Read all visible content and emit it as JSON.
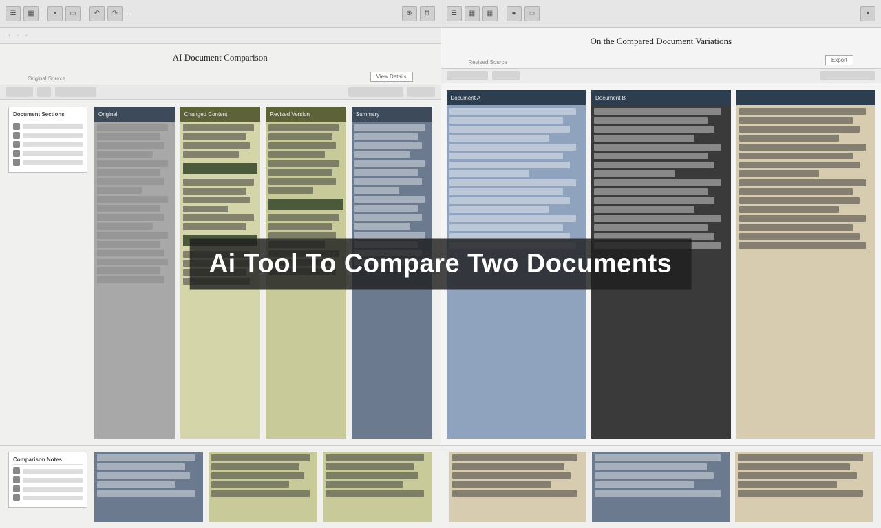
{
  "overlay_caption": "Ai Tool To Compare Two Documents",
  "left_pane": {
    "title": "AI Document Comparison",
    "subtitle": "Original Source",
    "meta_button": "View Details",
    "sidebar": {
      "group1_title": "Document Sections",
      "group2_title": "Comparison Notes"
    },
    "columns": [
      {
        "header": "Original",
        "variant": "dark"
      },
      {
        "header": "Changed Content",
        "variant": "olive"
      },
      {
        "header": "Revised Version",
        "variant": "olive"
      },
      {
        "header": "Summary",
        "variant": "dark"
      }
    ]
  },
  "right_pane": {
    "title": "On the Compared Document Variations",
    "subtitle": "Revised Source",
    "meta_button": "Export",
    "columns": [
      {
        "header": "Document A",
        "variant": "navy"
      },
      {
        "header": "Document B",
        "variant": "navy"
      }
    ]
  }
}
